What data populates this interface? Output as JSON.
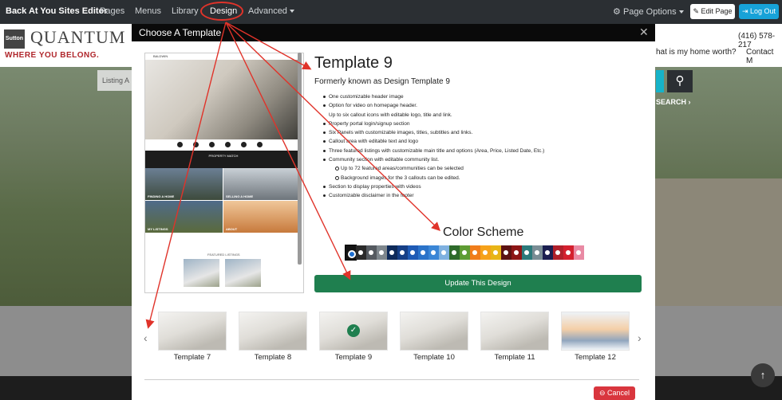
{
  "navbar": {
    "brand": "Back At You Sites Editor",
    "items": [
      "Pages",
      "Menus",
      "Library",
      "Design",
      "Advanced"
    ],
    "page_options": "Page Options",
    "edit_page": "Edit Page",
    "log_out": "Log Out"
  },
  "site": {
    "logo_badge": "Sutton",
    "logo_name": "QUANTUM",
    "tagline": "WHERE YOU BELONG.",
    "phone": "(416) 578-217",
    "link_home_worth": "hat is my home worth?",
    "link_contact": "Contact M",
    "listing_placeholder": "Listing A",
    "search_link": "SEARCH"
  },
  "modal": {
    "title": "Choose A Template",
    "template_name": "Template 9",
    "subtitle": "Formerly known as Design Template 9",
    "features": [
      {
        "level": 1,
        "text": "One customizable header image"
      },
      {
        "level": 1,
        "text": "Option for video on homepage header."
      },
      {
        "level": 0,
        "text": "Up to six callout icons with editable logo, title and link."
      },
      {
        "level": 1,
        "text": "Property portal login/signup section"
      },
      {
        "level": 1,
        "text": "Six Panels with customizable images, titles, subtitles and links."
      },
      {
        "level": 1,
        "text": "Callout area with editable text and logo"
      },
      {
        "level": 1,
        "text": "Three featured listings with customizable main title and options (Area, Price, Listed Date, Etc.)"
      },
      {
        "level": 1,
        "text": "Community section with editable community list."
      },
      {
        "level": 2,
        "text": "Up to 72 featured areas/communities can be selected"
      },
      {
        "level": 2,
        "text": "Background images for the 3 callouts can be edited."
      },
      {
        "level": 1,
        "text": "Section to display properties with videos"
      },
      {
        "level": 1,
        "text": "Customizable disclaimer in the footer"
      }
    ],
    "color_scheme_title": "Color Scheme",
    "swatches": [
      "#141414",
      "#2a2a2a",
      "#555a60",
      "#7f878d",
      "#0e2a5a",
      "#163f86",
      "#1f5bb5",
      "#2b73c9",
      "#3a86d6",
      "#7fb1e0",
      "#2e6b2b",
      "#5e9c33",
      "#f07d1b",
      "#f6a21a",
      "#e8b517",
      "#5c1212",
      "#8d1616",
      "#2c7a7b",
      "#7a8d95",
      "#1b1f50",
      "#b0202b",
      "#d4202e",
      "#e98aa4"
    ],
    "update_button": "Update This Design",
    "cancel_button": "Cancel",
    "preview": {
      "logo_text": "BALDWIN",
      "banner": "PROPERTY MATCH",
      "tiles": [
        "FINDING A HOME",
        "SELLING A HOME",
        "MY LISTINGS",
        "ABOUT"
      ],
      "featured_title": "FEATURED LISTINGS"
    },
    "thumbnails": [
      "Template 7",
      "Template 8",
      "Template 9",
      "Template 10",
      "Template 11",
      "Template 12"
    ],
    "selected_index": 2
  },
  "annotation_color": "#e0332a"
}
